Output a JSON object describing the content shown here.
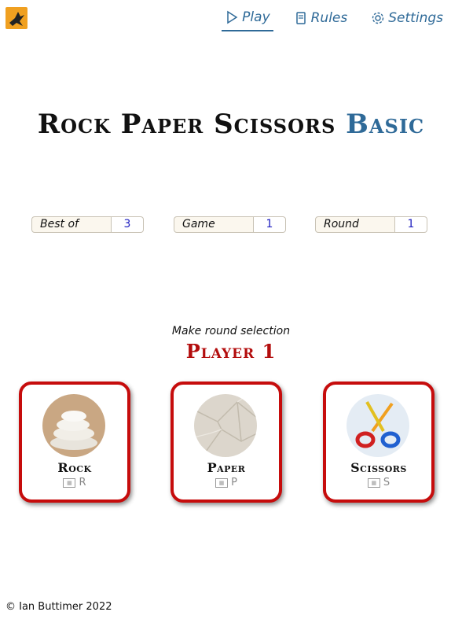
{
  "nav": {
    "items": [
      {
        "label": "Play",
        "icon": "play-icon",
        "active": true
      },
      {
        "label": "Rules",
        "icon": "book-icon",
        "active": false
      },
      {
        "label": "Settings",
        "icon": "gear-icon",
        "active": false
      }
    ]
  },
  "title": {
    "main": "Rock Paper Scissors",
    "accent": "Basic"
  },
  "stats": [
    {
      "label": "Best of",
      "value": "3"
    },
    {
      "label": "Game",
      "value": "1"
    },
    {
      "label": "Round",
      "value": "1"
    }
  ],
  "prompt": "Make round selection",
  "player": "Player 1",
  "choices": [
    {
      "name": "Rock",
      "key": "R",
      "icon": "rock-stack-image"
    },
    {
      "name": "Paper",
      "key": "P",
      "icon": "crumpled-paper-image"
    },
    {
      "name": "Scissors",
      "key": "S",
      "icon": "scissors-image"
    }
  ],
  "footer": "© Ian Buttimer 2022",
  "colors": {
    "accent": "#2f6a98",
    "player": "#b30d0d",
    "card_border": "#c60c0c",
    "logo_bg": "#f0a020",
    "stat_value": "#2020c0"
  }
}
